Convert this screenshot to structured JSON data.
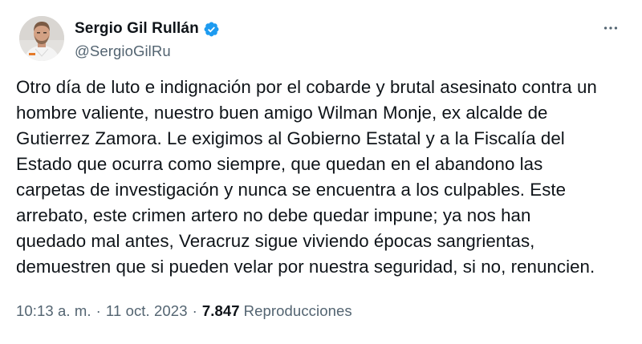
{
  "author": {
    "display_name": "Sergio Gil Rullán",
    "handle": "@SergioGilRu",
    "verified_icon": "verified-badge-icon",
    "avatar_icon": "profile-photo",
    "verified_color": "#1d9bf0"
  },
  "tweet": {
    "text": "Otro día de luto e indignación por el cobarde y brutal asesinato contra un\nhombre valiente, nuestro buen amigo Wilman Monje, ex alcalde de\nGutierrez Zamora. Le exigimos al Gobierno Estatal y a la Fiscalía del\nEstado que ocurra como siempre, que quedan en el abandono las\ncarpetas de investigación y nunca se encuentra a los culpables. Este\narrebato, este crimen artero no debe quedar impune; ya nos han\nquedado mal antes, Veracruz sigue viviendo épocas sangrientas,\ndemuestren que si pueden velar por nuestra seguridad, si no, renuncien."
  },
  "meta": {
    "time": "10:13 a. m.",
    "separator": "·",
    "date": "11 oct. 2023",
    "views_count": "7.847",
    "views_label": "Reproducciones"
  },
  "actions": {
    "more_icon": "more-options-icon"
  }
}
